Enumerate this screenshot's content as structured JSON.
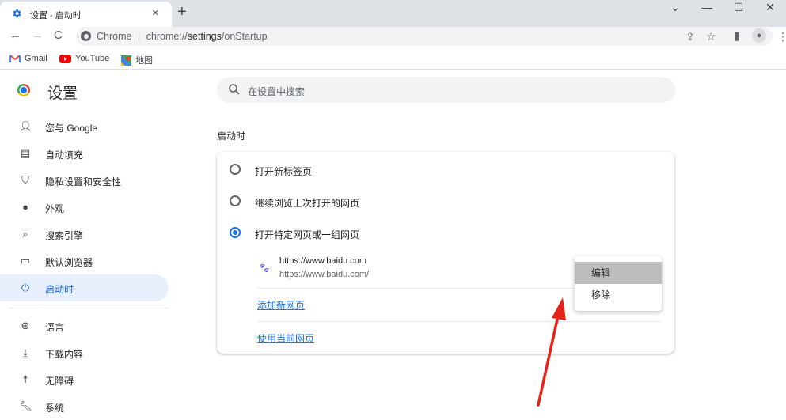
{
  "browser": {
    "tab_title": "设置 - 启动时",
    "tab_close": "×",
    "new_tab": "+",
    "url_host": "Chrome",
    "url_sep": "|",
    "url_scheme": "chrome://",
    "url_path_bold": "settings",
    "url_path_rest": "/onStartup",
    "window_controls": [
      "⌄",
      "—",
      "☐",
      "✕"
    ]
  },
  "bookmarks": [
    {
      "label": "Gmail",
      "icon": "gmail-icon"
    },
    {
      "label": "YouTube",
      "icon": "youtube-icon"
    },
    {
      "label": "地图",
      "icon": "maps-icon"
    }
  ],
  "settings": {
    "title": "设置",
    "search_placeholder": "在设置中搜索",
    "nav": [
      {
        "label": "您与 Google",
        "icon": "person-icon"
      },
      {
        "label": "自动填充",
        "icon": "clipboard-icon"
      },
      {
        "label": "隐私设置和安全性",
        "icon": "shield-icon"
      },
      {
        "label": "外观",
        "icon": "palette-icon"
      },
      {
        "label": "搜索引擎",
        "icon": "search-icon"
      },
      {
        "label": "默认浏览器",
        "icon": "browser-window-icon"
      },
      {
        "label": "启动时",
        "icon": "power-icon",
        "active": true
      },
      {
        "label": "语言",
        "icon": "globe-icon"
      },
      {
        "label": "下载内容",
        "icon": "download-icon"
      },
      {
        "label": "无障碍",
        "icon": "accessibility-icon"
      },
      {
        "label": "系统",
        "icon": "wrench-icon"
      }
    ],
    "section_title": "启动时",
    "options": [
      {
        "label": "打开新标签页",
        "selected": false
      },
      {
        "label": "继续浏览上次打开的网页",
        "selected": false
      },
      {
        "label": "打开特定网页或一组网页",
        "selected": true
      }
    ],
    "startup_page": {
      "title": "https://www.baidu.com",
      "url": "https://www.baidu.com/"
    },
    "add_page_link": "添加新网页",
    "use_current_link": "使用当前网页",
    "context_menu": [
      "编辑",
      "移除"
    ]
  },
  "colors": {
    "accent": "#1a73e8",
    "annotation_arrow": "#e5231b"
  }
}
